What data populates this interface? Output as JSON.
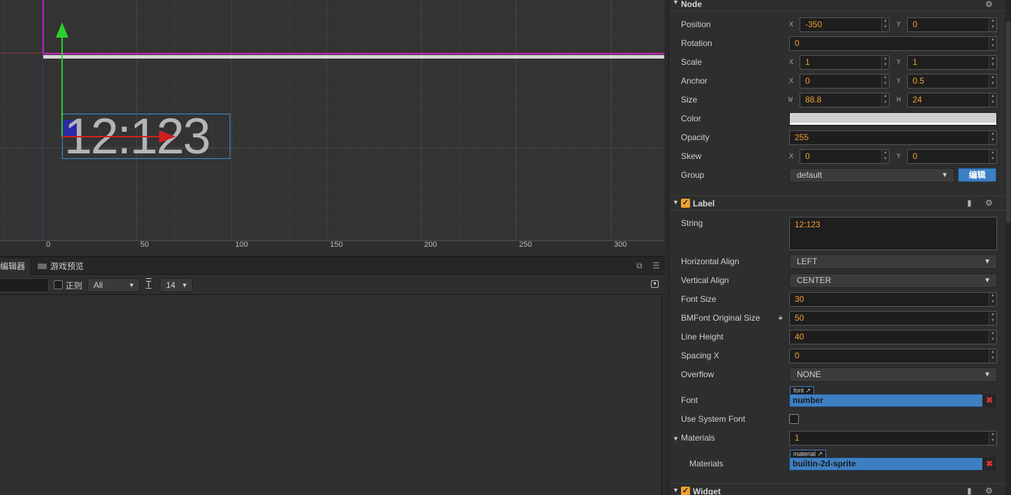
{
  "scene": {
    "label_text": "12:123",
    "ruler": [
      "0",
      "50",
      "100",
      "150",
      "200",
      "250",
      "300"
    ]
  },
  "console": {
    "tabs": [
      "编辑器",
      "游戏预览"
    ],
    "regex_label": "正则",
    "level_filter": "All",
    "font_size": "14"
  },
  "node": {
    "title": "Node",
    "position": {
      "label": "Position",
      "x": "-350",
      "y": "0"
    },
    "rotation": {
      "label": "Rotation",
      "value": "0"
    },
    "scale": {
      "label": "Scale",
      "x": "1",
      "y": "1"
    },
    "anchor": {
      "label": "Anchor",
      "x": "0",
      "y": "0.5"
    },
    "size": {
      "label": "Size",
      "w": "88.8",
      "h": "24"
    },
    "color": {
      "label": "Color",
      "value": "#cfcfcf"
    },
    "opacity": {
      "label": "Opacity",
      "value": "255"
    },
    "skew": {
      "label": "Skew",
      "x": "0",
      "y": "0"
    },
    "group": {
      "label": "Group",
      "value": "default",
      "edit_button": "编辑"
    },
    "axis": {
      "x": "X",
      "y": "Y",
      "w": "W",
      "h": "H"
    }
  },
  "label": {
    "title": "Label",
    "string": {
      "label": "String",
      "value": "12:123"
    },
    "horizontal_align": {
      "label": "Horizontal Align",
      "value": "LEFT"
    },
    "vertical_align": {
      "label": "Vertical Align",
      "value": "CENTER"
    },
    "font_size": {
      "label": "Font Size",
      "value": "30"
    },
    "bmfont_original_size": {
      "label": "BMFont Original Size",
      "value": "50"
    },
    "line_height": {
      "label": "Line Height",
      "value": "40"
    },
    "spacing_x": {
      "label": "Spacing X",
      "value": "0"
    },
    "overflow": {
      "label": "Overflow",
      "value": "NONE"
    },
    "font": {
      "label": "Font",
      "tag": "font",
      "value": "number"
    },
    "use_system_font": {
      "label": "Use System Font"
    },
    "materials": {
      "label": "Materials",
      "count": "1"
    },
    "material_item": {
      "label": "Materials",
      "tag": "material",
      "value": "builtin-2d-sprite"
    }
  },
  "widget": {
    "title": "Widget"
  }
}
